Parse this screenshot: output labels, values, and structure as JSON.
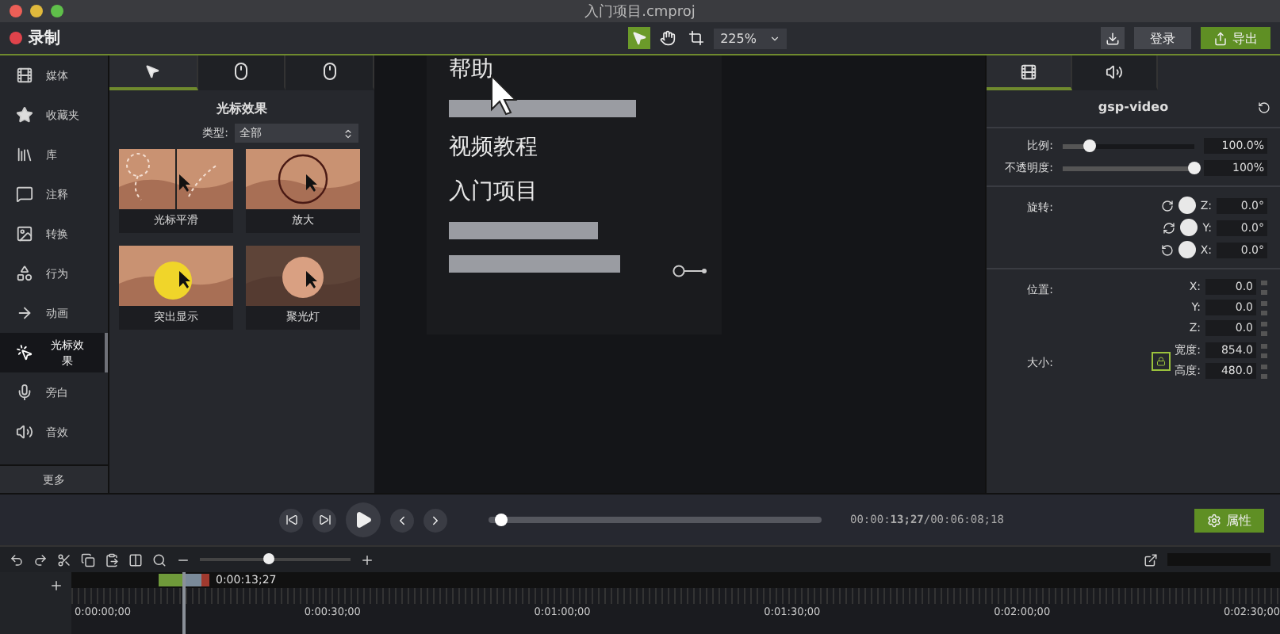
{
  "window": {
    "title": "入门项目.cmproj"
  },
  "toolbar": {
    "record": "录制",
    "tools": [
      {
        "kind": "pointer",
        "selected": true
      },
      {
        "kind": "hand",
        "selected": false
      },
      {
        "kind": "crop",
        "selected": false
      }
    ],
    "zoom": "225%",
    "login": "登录",
    "export": "导出"
  },
  "sidebar": {
    "items": [
      {
        "kind": "media",
        "label": "媒体",
        "selected": false
      },
      {
        "kind": "favorites",
        "label": "收藏夹",
        "selected": false
      },
      {
        "kind": "library",
        "label": "库",
        "selected": false
      },
      {
        "kind": "annotations",
        "label": "注释",
        "selected": false
      },
      {
        "kind": "transitions",
        "label": "转换",
        "selected": false
      },
      {
        "kind": "behaviors",
        "label": "行为",
        "selected": false
      },
      {
        "kind": "animations",
        "label": "动画",
        "selected": false
      },
      {
        "kind": "cursor",
        "label": "光标效果",
        "selected": true
      },
      {
        "kind": "narration",
        "label": "旁白",
        "selected": false
      },
      {
        "kind": "audio",
        "label": "音效",
        "selected": false
      }
    ],
    "more": "更多"
  },
  "panel": {
    "tabs": [
      {
        "kind": "pointer",
        "selected": true
      },
      {
        "kind": "mouse-left",
        "selected": false
      },
      {
        "kind": "mouse-right",
        "selected": false
      }
    ],
    "title": "光标效果",
    "filter": {
      "label": "类型:",
      "value": "全部"
    },
    "effects": [
      {
        "kind": "smooth",
        "label": "光标平滑"
      },
      {
        "kind": "magnify",
        "label": "放大"
      },
      {
        "kind": "highlight",
        "label": "突出显示"
      },
      {
        "kind": "spotlight",
        "label": "聚光灯"
      }
    ]
  },
  "canvas": {
    "lines": [
      {
        "kind": "text",
        "label": "帮助"
      },
      {
        "kind": "bar"
      },
      {
        "kind": "text",
        "label": "视频教程"
      },
      {
        "kind": "text",
        "label": "入门项目"
      },
      {
        "kind": "bar"
      },
      {
        "kind": "bar"
      }
    ]
  },
  "properties": {
    "tabs": [
      {
        "kind": "video",
        "selected": true
      },
      {
        "kind": "audio",
        "selected": false
      }
    ],
    "title": "gsp-video",
    "sliders": [
      {
        "label": "比例:",
        "level": 0.2,
        "value": "100.0%"
      },
      {
        "label": "不透明度:",
        "level": 1,
        "value": "100%"
      }
    ],
    "rotation": {
      "label": "旋转:",
      "axes": [
        {
          "kind": "z",
          "axis": "Z:",
          "value": "0.0°"
        },
        {
          "kind": "y",
          "axis": "Y:",
          "value": "0.0°"
        },
        {
          "kind": "x",
          "axis": "X:",
          "value": "0.0°"
        }
      ]
    },
    "position": {
      "label": "位置:",
      "axes": [
        {
          "axis": "X:",
          "value": "0.0"
        },
        {
          "axis": "Y:",
          "value": "0.0"
        },
        {
          "axis": "Z:",
          "value": "0.0"
        }
      ]
    },
    "size": {
      "label": "大小:",
      "locked": true,
      "fields": [
        {
          "label": "宽度:",
          "value": "854.0"
        },
        {
          "label": "高度:",
          "value": "480.0"
        }
      ]
    }
  },
  "playback": {
    "progress": {
      "level": 0.04
    },
    "time": "00:00:**13;27**/00:06:08;18",
    "properties_button": "属性"
  },
  "timeline": {
    "zoom": {
      "level": 0.45
    },
    "playhead": "0:00:13;27",
    "ticks": [
      "0:00:00;00",
      "0:00:30;00",
      "0:01:00;00",
      "0:01:30;00",
      "0:02:00;00",
      "0:02:30;00"
    ]
  }
}
